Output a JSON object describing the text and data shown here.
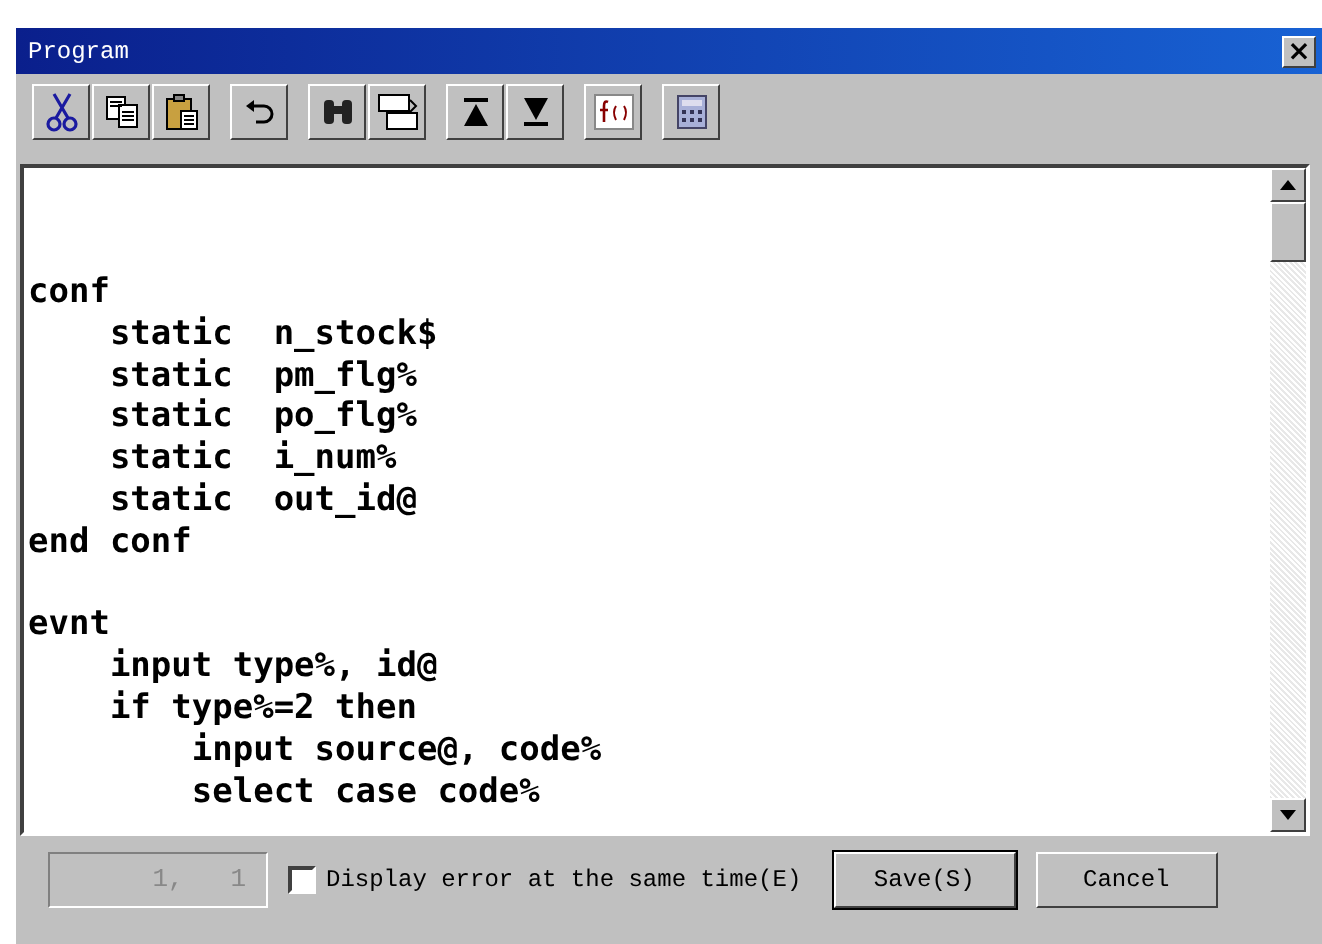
{
  "window": {
    "title": "Program",
    "close": "×"
  },
  "toolbar": [
    [
      {
        "kind": "cut"
      },
      {
        "kind": "copy"
      },
      {
        "kind": "paste"
      }
    ],
    [
      {
        "kind": "undo"
      }
    ],
    [
      {
        "kind": "find"
      },
      {
        "kind": "replace"
      }
    ],
    [
      {
        "kind": "top"
      },
      {
        "kind": "bottom"
      }
    ],
    [
      {
        "kind": "function"
      }
    ],
    [
      {
        "kind": "calculator"
      }
    ]
  ],
  "editor": {
    "blocks": [
      [
        "conf",
        "    static  n_stock$",
        "    static  pm_flg%",
        "    static  po_flg%",
        "    static  i_num%",
        "    static  out_id@",
        "end conf"
      ],
      [
        "evnt",
        "    input type%, id@",
        "    if type%=2 then",
        "        input source@, code%",
        "        select case code%"
      ]
    ]
  },
  "status_bar": {
    "position": "1,   1",
    "display_error": {
      "label": "Display error at the same time(E)",
      "checked": false
    },
    "buttons": [
      "Save(S)",
      "Cancel"
    ]
  }
}
